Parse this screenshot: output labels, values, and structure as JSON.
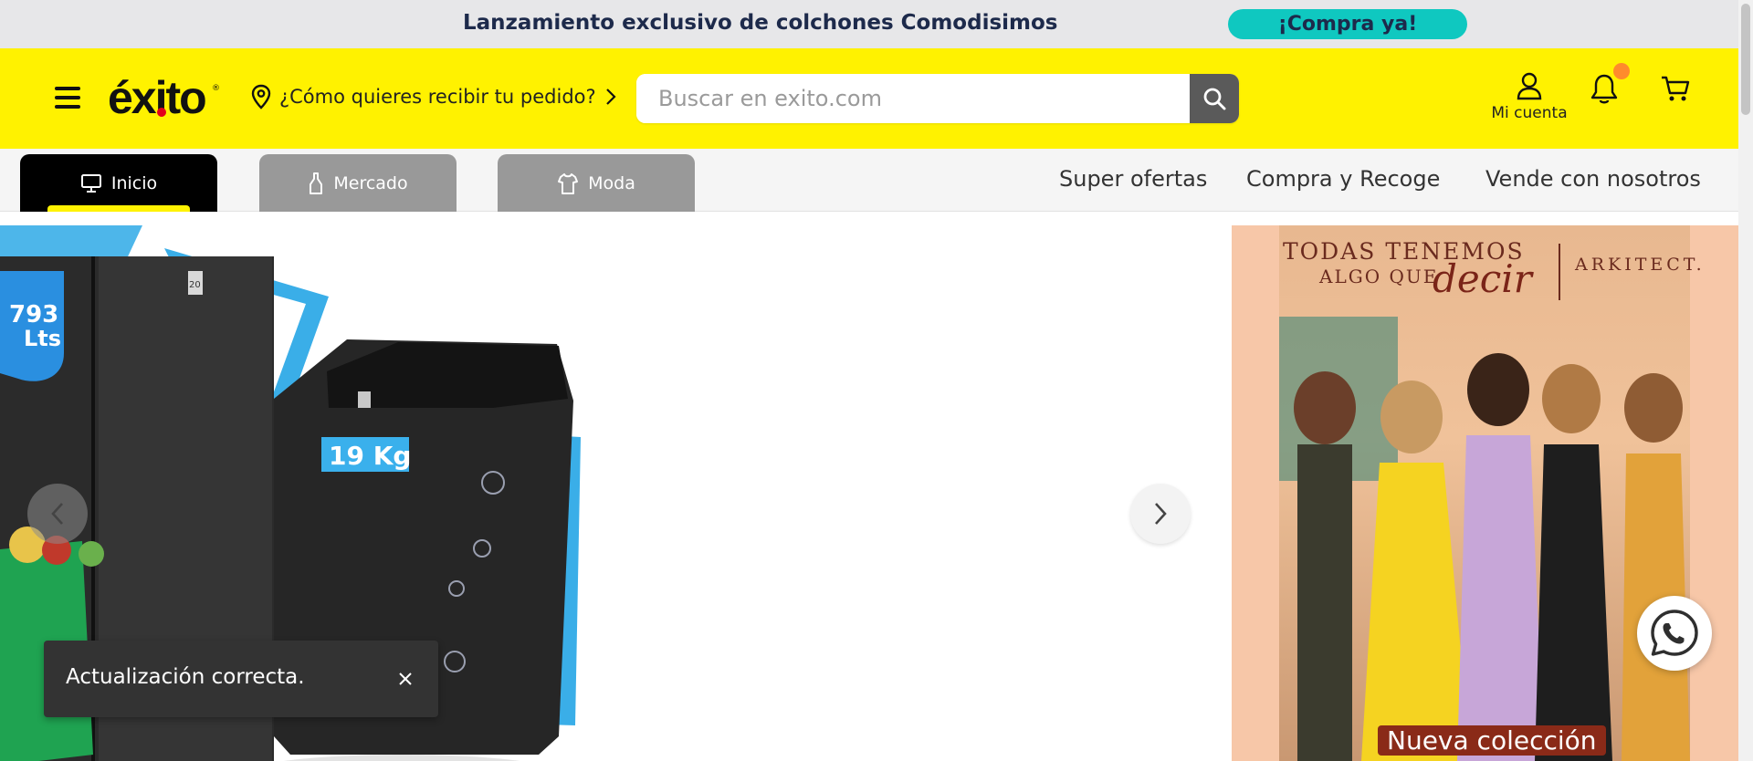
{
  "promo": {
    "text": "Lanzamiento exclusivo de colchones Comodisimos",
    "cta": "¡Compra ya!"
  },
  "header": {
    "logo": "éxito",
    "logo_mark": "®",
    "delivery_prompt": "¿Cómo quieres recibir tu pedido?",
    "search_placeholder": "Buscar en exito.com",
    "account_label": "Mi cuenta"
  },
  "nav": {
    "tabs": [
      {
        "label": "Inicio",
        "icon": "monitor-icon",
        "active": true
      },
      {
        "label": "Mercado",
        "icon": "bottle-icon",
        "active": false
      },
      {
        "label": "Moda",
        "icon": "shirt-icon",
        "active": false
      }
    ],
    "links": [
      "Super ofertas",
      "Compra y Recoge",
      "Vende con nosotros"
    ]
  },
  "hero": {
    "fridge_badge_value": "793",
    "fridge_badge_unit": "Lts",
    "washer_badge": "19 Kg",
    "fridge_seal": "20"
  },
  "side_promo": {
    "line1": "TODAS TENEMOS",
    "line2": "ALGO QUE",
    "script": "decir",
    "brand": "ARKITECT.",
    "caption": "Nueva colección"
  },
  "toast": {
    "message": "Actualización correcta."
  },
  "colors": {
    "brand_yellow": "#fff200",
    "promo_cta": "#0fc8c0",
    "promo_text": "#1d2a4b",
    "notification": "#ff8b2c",
    "logo_dot": "#e3001b"
  }
}
